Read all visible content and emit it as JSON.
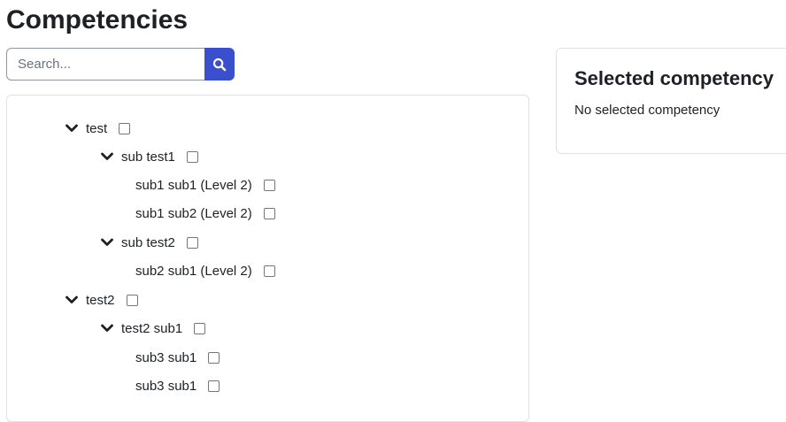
{
  "page": {
    "title": "Competencies"
  },
  "search": {
    "placeholder": "Search..."
  },
  "tree": {
    "items": [
      {
        "label": "test",
        "expanded": true
      },
      {
        "label": "sub test1",
        "expanded": true
      },
      {
        "label": "sub1 sub1 (Level 2)"
      },
      {
        "label": "sub1 sub2 (Level 2)"
      },
      {
        "label": "sub test2",
        "expanded": true
      },
      {
        "label": "sub2 sub1 (Level 2)"
      },
      {
        "label": "test2",
        "expanded": true
      },
      {
        "label": "test2 sub1",
        "expanded": true
      },
      {
        "label": "sub3 sub1"
      },
      {
        "label": "sub3 sub1"
      }
    ]
  },
  "selected": {
    "title": "Selected competency",
    "empty_text": "No selected competency"
  },
  "colors": {
    "accent": "#3a4fcd",
    "text": "#1d2125",
    "border": "#dee2e6"
  },
  "icons": {
    "search": "search-icon",
    "expand": "chevron-down-icon"
  }
}
